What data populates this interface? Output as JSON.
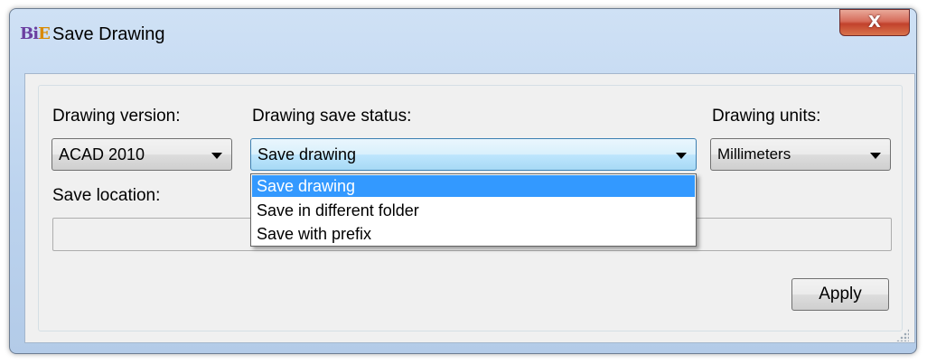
{
  "window": {
    "title": "Save Drawing",
    "icon_text_b": "Bi",
    "icon_text_e": "E",
    "close_label": "X"
  },
  "fields": {
    "version_label": "Drawing version:",
    "version_value": "ACAD 2010",
    "status_label": "Drawing save status:",
    "status_value": "Save drawing",
    "units_label": "Drawing units:",
    "units_value": "Millimeters",
    "location_label": "Save location:",
    "location_value": ""
  },
  "dropdown": {
    "items": [
      {
        "label": "Save drawing",
        "selected": true
      },
      {
        "label": "Save in different folder",
        "selected": false
      },
      {
        "label": "Save with prefix",
        "selected": false
      }
    ]
  },
  "buttons": {
    "apply_label": "Apply"
  },
  "colors": {
    "selection": "#3399ff",
    "close_button": "#c2412c",
    "title_bar": "#bcd3ee"
  }
}
